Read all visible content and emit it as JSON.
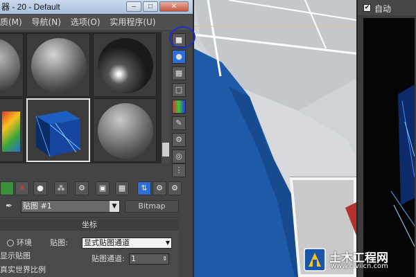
{
  "window": {
    "title": "器 - 20 - Default"
  },
  "menu": [
    "质(M)",
    "导航(N)",
    "选项(O)",
    "实用程序(U)"
  ],
  "material": {
    "name_prefix": "贴图",
    "name": "#1",
    "type": "Bitmap"
  },
  "coords": {
    "header": "坐标",
    "env_label": "环境",
    "map_label": "贴图:",
    "map_value": "显式贴图通道",
    "show_map": "显示贴图",
    "channel_label": "贴图通道:",
    "channel_value": "1",
    "real_world": "真实世界比例"
  },
  "right_panel": {
    "auto_label": "自动",
    "auto_checked": "✔"
  },
  "watermark": {
    "cn": "土木工程网",
    "url": "www.civilcn.com"
  },
  "colors": {
    "accent": "#2d6fd6",
    "annotation": "#1b31c9",
    "viewport_blue": "#1e5aa8"
  }
}
